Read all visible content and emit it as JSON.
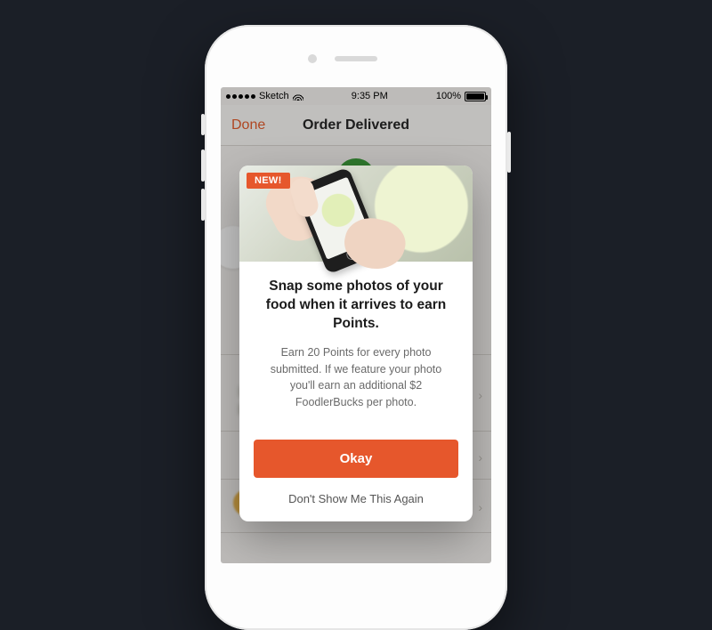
{
  "statusbar": {
    "carrier": "Sketch",
    "time": "9:35 PM",
    "battery_pct": "100%"
  },
  "navbar": {
    "done_label": "Done",
    "title": "Order Delivered"
  },
  "modal": {
    "badge": "NEW!",
    "heading": "Snap some photos of your food when it arrives to earn Points.",
    "body": "Earn 20 Points for every photo submitted. If we feature your photo you'll earn an additional $2 FoodlerBucks per photo.",
    "okay_label": "Okay",
    "dont_show_label": "Don't Show Me This Again"
  },
  "colors": {
    "accent": "#e6572c",
    "success": "#3d9a3a"
  }
}
